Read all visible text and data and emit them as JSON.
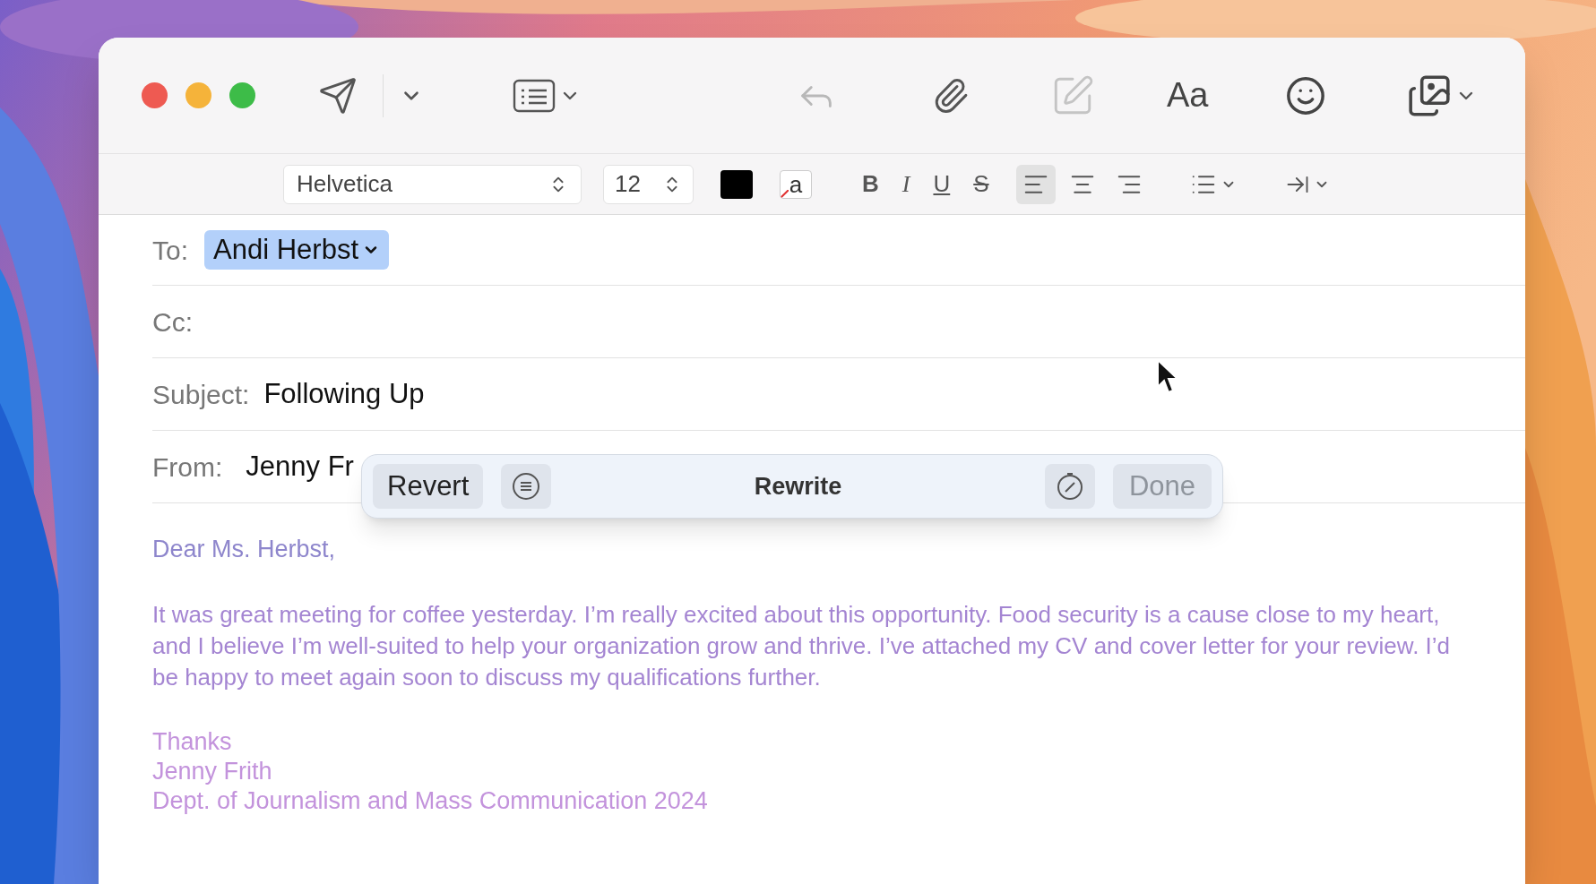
{
  "toolbar": {
    "font_button": "Aa"
  },
  "format_bar": {
    "font": "Helvetica",
    "size": "12",
    "highlight_glyph": "a",
    "style_buttons": [
      {
        "kind": "bold",
        "glyph": "B"
      },
      {
        "kind": "italic",
        "glyph": "I"
      },
      {
        "kind": "underline",
        "glyph": "U"
      },
      {
        "kind": "strike",
        "glyph": "S"
      }
    ],
    "alignments": [
      {
        "kind": "left",
        "selected": true
      },
      {
        "kind": "center",
        "selected": false
      },
      {
        "kind": "right",
        "selected": false
      }
    ]
  },
  "header": {
    "to": {
      "label": "To:",
      "recipients": [
        "Andi Herbst"
      ]
    },
    "cc": {
      "label": "Cc:"
    },
    "subject": {
      "label": "Subject:",
      "value": "Following Up"
    },
    "from": {
      "label": "From:",
      "value": "Jenny Fr"
    }
  },
  "rewrite_bar": {
    "revert": "Revert",
    "title": "Rewrite",
    "done": {
      "label": "Done",
      "disabled": true
    }
  },
  "body": {
    "greeting": "Dear Ms. Herbst,",
    "paragraph": "It was great meeting for coffee yesterday. I’m really excited about this opportunity. Food security is a cause close to my heart, and I believe I’m well-suited to help your organization grow and thrive. I’ve attached my CV and cover letter for your review. I’d be happy to meet again soon to discuss my qualifications further.",
    "signature": [
      "Thanks",
      "Jenny Frith",
      "Dept. of Journalism and Mass Communication 2024"
    ]
  }
}
